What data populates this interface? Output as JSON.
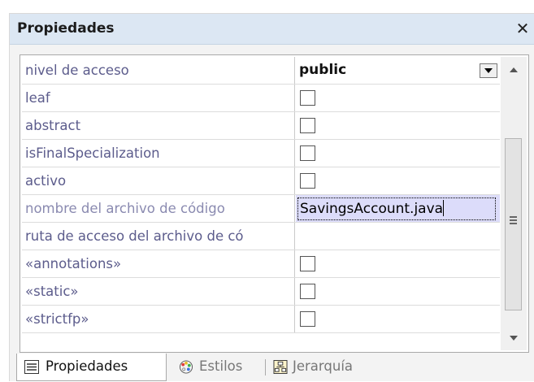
{
  "panel": {
    "title": "Propiedades",
    "close_symbol": "✕",
    "close_icon": "close-icon"
  },
  "properties": [
    {
      "name": "nivel de acceso",
      "type": "select",
      "value": "public"
    },
    {
      "name": "leaf",
      "type": "checkbox",
      "checked": false
    },
    {
      "name": "abstract",
      "type": "checkbox",
      "checked": false
    },
    {
      "name": "isFinalSpecialization",
      "type": "checkbox",
      "checked": false
    },
    {
      "name": "activo",
      "type": "checkbox",
      "checked": false
    },
    {
      "name": "nombre del archivo de código",
      "type": "text-edit",
      "value": "SavingsAccount.java"
    },
    {
      "name": "ruta de acceso del archivo de có",
      "type": "text",
      "value": ""
    },
    {
      "name": "«annotations»",
      "type": "checkbox",
      "checked": false
    },
    {
      "name": "«static»",
      "type": "checkbox",
      "checked": false
    },
    {
      "name": "«strictfp»",
      "type": "checkbox",
      "checked": false
    }
  ],
  "tabs": [
    {
      "label": "Propiedades",
      "icon": "properties-list-icon",
      "active": true
    },
    {
      "label": "Estilos",
      "icon": "palette-icon",
      "active": false
    },
    {
      "label": "Jerarquía",
      "icon": "hierarchy-icon",
      "active": false
    }
  ],
  "colors": {
    "title_bar": "#dce7f3",
    "property_name": "#5c5c8c",
    "edit_highlight": "#dcdcfa"
  }
}
